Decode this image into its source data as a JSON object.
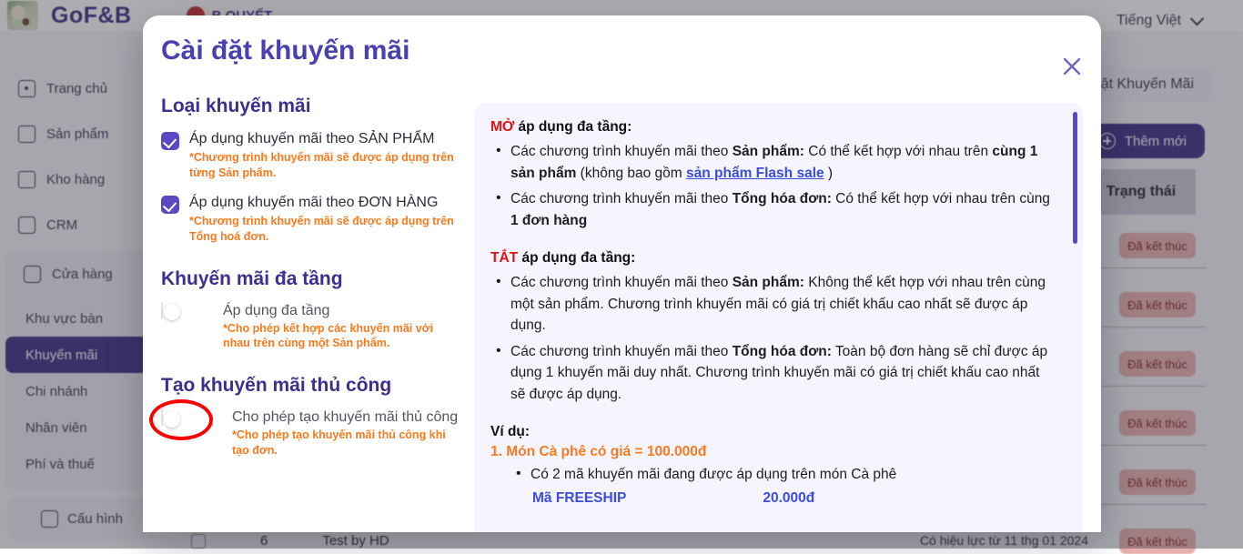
{
  "background": {
    "brand_name": "GoF&B",
    "noti_label": "B QUYẾT",
    "language": "Tiếng Việt",
    "page_tab": "Cài Đặt Khuyến Mãi",
    "add_button": "Thêm mới",
    "table_header_status": "Trạng thái",
    "status_badges": [
      "Đã kết thúc",
      "Đã kết thúc",
      "Đã kết thúc",
      "Đã kết thúc",
      "Đã kết thúc",
      "Đã kết thúc"
    ],
    "last_row": {
      "index": "6",
      "name": "Test by HD",
      "date": "Có hiệu lực từ 11 thg 01 2024"
    },
    "sidebar": {
      "items": [
        {
          "label": "Trang chủ",
          "icon": "home-icon"
        },
        {
          "label": "Sản phẩm",
          "icon": "product-icon"
        },
        {
          "label": "Kho hàng",
          "icon": "warehouse-icon"
        },
        {
          "label": "CRM",
          "icon": "crm-icon"
        },
        {
          "label": "Cửa hàng",
          "icon": "store-icon"
        }
      ],
      "sub_items": [
        {
          "label": "Khu vực bàn",
          "active": false
        },
        {
          "label": "Khuyến mãi",
          "active": true
        },
        {
          "label": "Chi nhánh",
          "active": false
        },
        {
          "label": "Nhân viên",
          "active": false
        },
        {
          "label": "Phí và thuế",
          "active": false
        }
      ],
      "config_label": "Cấu hình"
    }
  },
  "modal": {
    "title": "Cài đặt khuyến mãi",
    "close_icon": "close-icon",
    "left": {
      "section1_title": "Loại khuyến mãi",
      "option1_label": "Áp dụng khuyến mãi theo SẢN PHẨM",
      "option1_note": "*Chương trình khuyến mãi sẽ được áp dụng trên từng Sản phẩm.",
      "option1_checked": true,
      "option2_label": "Áp dụng khuyến mãi theo ĐƠN HÀNG",
      "option2_note": "*Chương trình khuyến mãi sẽ được áp dụng trên Tổng hoá đơn.",
      "option2_checked": true,
      "section2_title": "Khuyến mãi đa tầng",
      "toggle1_label": "Áp dụng đa tầng",
      "toggle1_note": "*Cho phép kết hợp các khuyến mãi với nhau trên cùng một Sản phẩm.",
      "toggle1_on": false,
      "section3_title": "Tạo khuyến mãi thủ công",
      "toggle2_label": "Cho phép tạo khuyến mãi thủ công",
      "toggle2_note": "*Cho phép tạo khuyến mãi thủ công khi tạo đơn.",
      "toggle2_on": false,
      "toggle2_highlighted": true
    },
    "info": {
      "on_heading_red": "MỞ",
      "on_heading_rest": " áp dụng đa tầng:",
      "on_items": [
        {
          "parts": [
            {
              "t": "Các chương trình khuyến mãi theo ",
              "s": "n"
            },
            {
              "t": "Sản phẩm:",
              "s": "b"
            },
            {
              "t": " Có thể kết hợp với nhau trên ",
              "s": "n"
            },
            {
              "t": "cùng 1 sản phẩm",
              "s": "b"
            },
            {
              "t": " (không bao gồm ",
              "s": "n"
            },
            {
              "t": "sản phẩm Flash sale",
              "s": "link"
            },
            {
              "t": " )",
              "s": "n"
            }
          ]
        },
        {
          "parts": [
            {
              "t": "Các chương trình khuyến mãi theo ",
              "s": "n"
            },
            {
              "t": "Tổng hóa đơn:",
              "s": "b"
            },
            {
              "t": " Có thể kết hợp với nhau trên cùng ",
              "s": "n"
            },
            {
              "t": "1 đơn hàng",
              "s": "b"
            }
          ]
        }
      ],
      "off_heading_red": "TẮT",
      "off_heading_rest": " áp dụng đa tầng:",
      "off_items": [
        {
          "parts": [
            {
              "t": "Các chương trình khuyến mãi theo ",
              "s": "n"
            },
            {
              "t": "Sản phẩm:",
              "s": "b"
            },
            {
              "t": " Không thể kết hợp với nhau trên cùng một sản phẩm. Chương trình khuyến mãi có giá trị chiết khấu cao nhất sẽ được áp dụng.",
              "s": "n"
            }
          ]
        },
        {
          "parts": [
            {
              "t": "Các chương trình khuyến mãi theo ",
              "s": "n"
            },
            {
              "t": "Tổng hóa đơn:",
              "s": "b"
            },
            {
              "t": " Toàn bộ đơn hàng sẽ chỉ được áp dụng 1 khuyến mãi duy nhất. Chương trình khuyến mãi có giá trị chiết khấu cao nhất sẽ được áp dụng.",
              "s": "n"
            }
          ]
        }
      ],
      "example_heading": "Ví dụ:",
      "example_item1": "1. Món Cà phê có giá = 100.000đ",
      "example_sub1": "Có 2 mã khuyến mãi đang được áp dụng trên món Cà phê",
      "example_cut_code": "Mã FREESHIP",
      "example_cut_value": "20.000đ"
    }
  }
}
